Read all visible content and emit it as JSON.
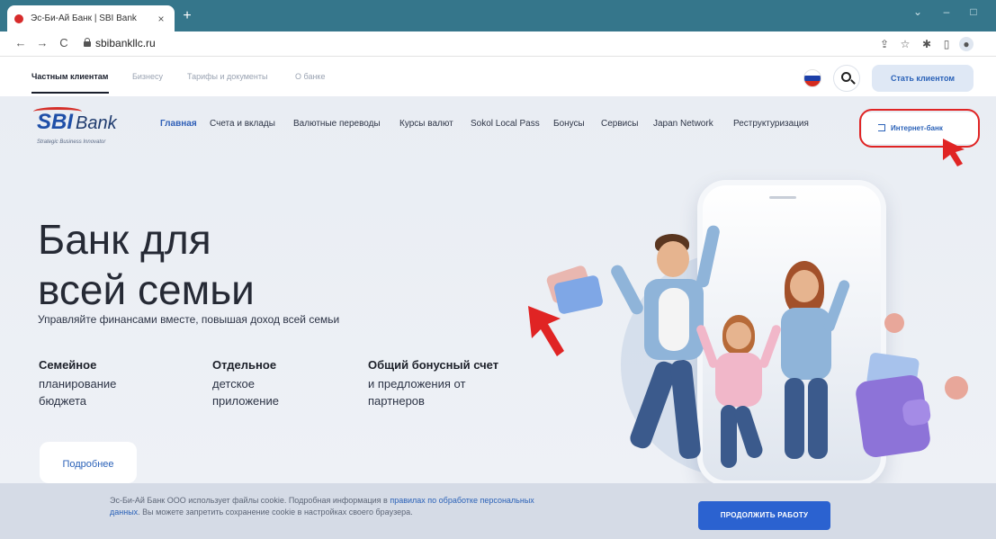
{
  "browser": {
    "tab_title": "Эс-Би-Ай Банк | SBI Bank",
    "tab_close": "×",
    "new_tab": "+",
    "url": "sbibankllc.ru",
    "controls": {
      "back": "←",
      "forward": "→",
      "reload": "C",
      "minimize": "–",
      "maximize": "□",
      "collapse": "⌄"
    }
  },
  "top_nav": {
    "segments": [
      "Частным клиентам",
      "Бизнесу",
      "Тарифы и документы",
      "О банке"
    ],
    "become_client": "Стать клиентом"
  },
  "logo": {
    "sbi": "SBI",
    "bank": "Bank",
    "tagline": "Strategic Business Innovator"
  },
  "main_menu": [
    "Главная",
    "Счета и вклады",
    "Валютные переводы",
    "Курсы валют",
    "Sokol Local Pass",
    "Бонусы",
    "Сервисы",
    "Japan Network",
    "Реструктуризация"
  ],
  "internet_bank": "Интернет-банк",
  "hero": {
    "title_line1": "Банк для",
    "title_line2": "всей семьи",
    "subtitle": "Управляйте финансами вместе, повышая доход всей семьи",
    "features": [
      {
        "title": "Семейное",
        "line1": "планирование",
        "line2": "бюджета"
      },
      {
        "title": "Отдельное",
        "line1": "детское",
        "line2": "приложение"
      },
      {
        "title": "Общий бонусный счет",
        "line1": "и предложения от",
        "line2": "партнеров"
      }
    ],
    "more_button": "Подробнее"
  },
  "cookie": {
    "text_part1": "Эс-Би-Ай Банк ООО использует файлы cookie. Подробная информация в ",
    "link_text": "правилах по обработке персональных данных",
    "text_part2": ". Вы можете запретить сохранение cookie в настройках своего браузера.",
    "button": "ПРОДОЛЖИТЬ РАБОТУ"
  },
  "colors": {
    "accent": "#2b62b8",
    "highlight_red": "#e02424",
    "browser_frame": "#35768b"
  }
}
